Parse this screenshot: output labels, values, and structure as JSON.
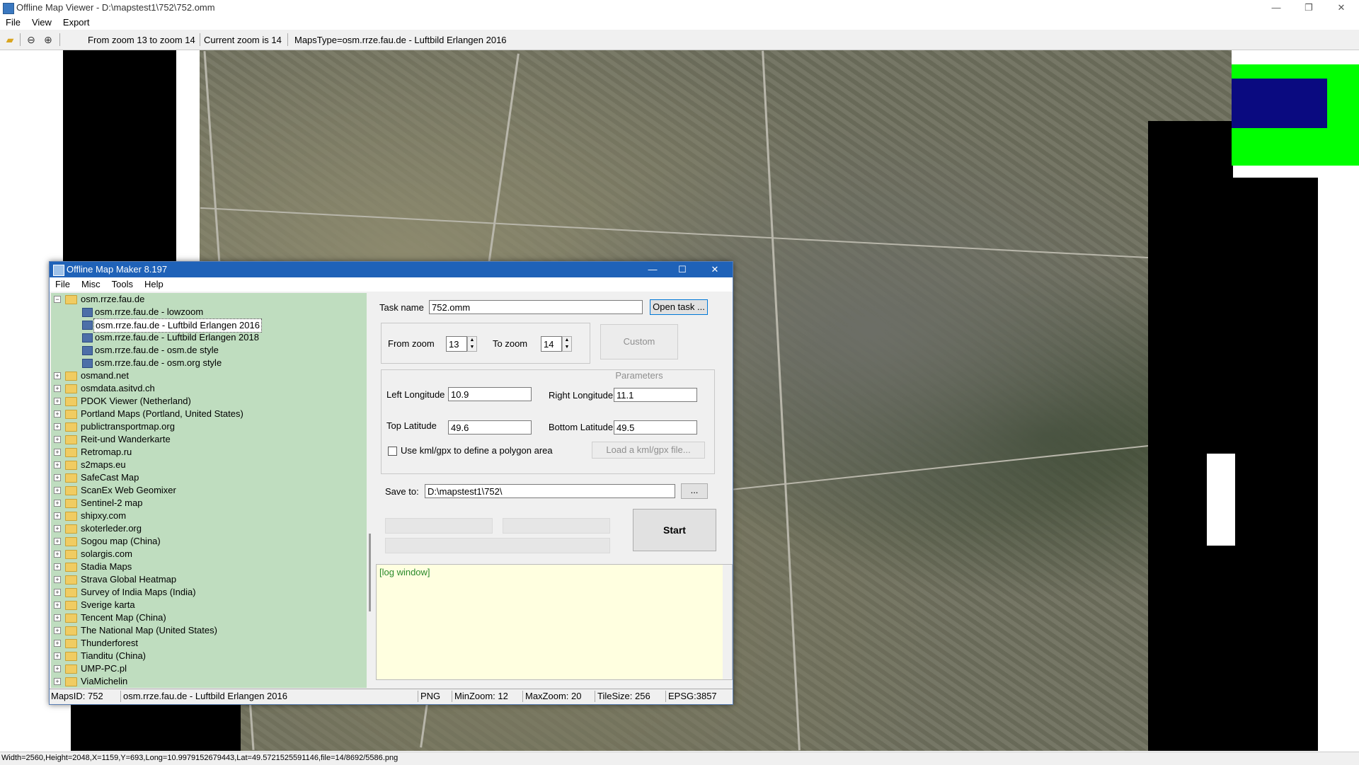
{
  "window": {
    "title": "Offline Map Viewer - D:\\mapstest1\\752\\752.omm",
    "controls": {
      "minimize": "—",
      "restore": "❐",
      "close": "✕"
    }
  },
  "menu": [
    "File",
    "View",
    "Export"
  ],
  "toolbar": {
    "zoom_range": "From zoom 13 to zoom 14",
    "current_zoom": "Current zoom is 14",
    "maps_type": "MapsType=osm.rrze.fau.de - Luftbild Erlangen 2016"
  },
  "map": {
    "colors": {
      "overlay_blue": "#0a0a80",
      "overlay_green": "#00ff00",
      "mask": "#000000"
    }
  },
  "dialog": {
    "title": "Offline Map Maker 8.197",
    "menu": [
      "File",
      "Misc",
      "Tools",
      "Help"
    ],
    "tree": {
      "root": "osm.rrze.fau.de",
      "children": [
        "osm.rrze.fau.de - lowzoom",
        "osm.rrze.fau.de - Luftbild Erlangen 2016",
        "osm.rrze.fau.de - Luftbild Erlangen 2018",
        "osm.rrze.fau.de - osm.de style",
        "osm.rrze.fau.de - osm.org style"
      ],
      "selected_index": 1,
      "folders": [
        "osmand.net",
        "osmdata.asitvd.ch",
        "PDOK Viewer (Netherland)",
        "Portland Maps (Portland, United States)",
        "publictransportmap.org",
        "Reit-und Wanderkarte",
        "Retromap.ru",
        "s2maps.eu",
        "SafeCast Map",
        "ScanEx Web Geomixer",
        "Sentinel-2 map",
        "shipxy.com",
        "skoterleder.org",
        "Sogou map (China)",
        "solargis.com",
        "Stadia Maps",
        "Strava Global Heatmap",
        "Survey of India Maps (India)",
        "Sverige karta",
        "Tencent Map (China)",
        "The National Map (United States)",
        "Thunderforest",
        "Tianditu (China)",
        "UMP-PC.pl",
        "ViaMichelin"
      ]
    },
    "form": {
      "task_name_label": "Task name",
      "task_name_value": "752.omm",
      "open_task_button": "Open task ...",
      "from_zoom_label": "From zoom",
      "from_zoom_value": "13",
      "to_zoom_label": "To zoom",
      "to_zoom_value": "14",
      "custom_params_button": "Custom Parameters",
      "left_lon_label": "Left Longitude",
      "left_lon_value": "10.9",
      "right_lon_label": "Right Longitude",
      "right_lon_value": "11.1",
      "top_lat_label": "Top Latitude",
      "top_lat_value": "49.6",
      "bottom_lat_label": "Bottom Latitude",
      "bottom_lat_value": "49.5",
      "use_kml_label": "Use kml/gpx to define a polygon area",
      "load_kml_button": "Load a kml/gpx file...",
      "save_to_label": "Save to:",
      "save_to_value": "D:\\mapstest1\\752\\",
      "browse_button": "...",
      "start_button": "Start"
    },
    "log": "[log window]",
    "status": {
      "maps_id": "MapsID: 752",
      "map_name": "osm.rrze.fau.de - Luftbild Erlangen 2016",
      "format": "PNG",
      "min_zoom": "MinZoom: 12",
      "max_zoom": "MaxZoom: 20",
      "tile_size": "TileSize: 256",
      "epsg": "EPSG:3857"
    }
  },
  "statusbar": "Width=2560,Height=2048,X=1159,Y=693,Long=10.9979152679443,Lat=49.5721525591146,file=14/8692/5586.png"
}
